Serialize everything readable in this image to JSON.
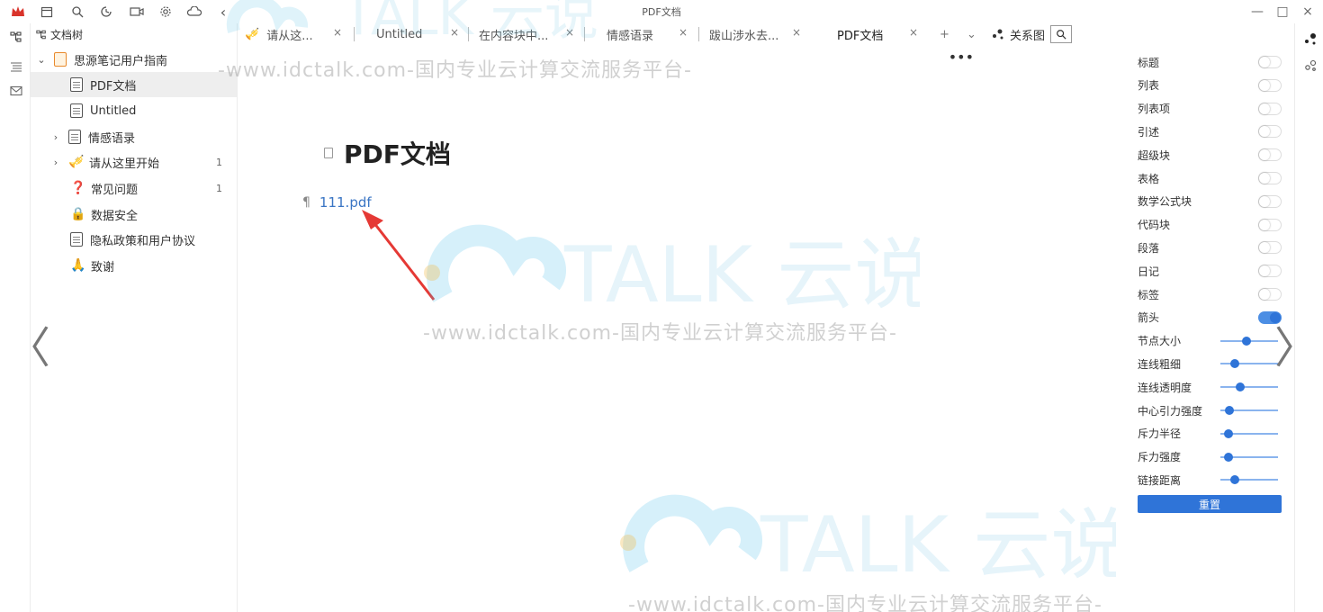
{
  "window": {
    "title": "PDF文档",
    "minimize": "—",
    "maximize": "□",
    "close": "×"
  },
  "toolbar": {
    "icons": [
      "logo-crown-icon",
      "calendar-icon",
      "search-icon",
      "history-icon",
      "record-icon",
      "settings-icon",
      "cloud-icon",
      "collapse-icon"
    ]
  },
  "filetree": {
    "header": "文档树",
    "items": [
      {
        "label": "思源笔记用户指南",
        "kind": "notebook",
        "expanded": true,
        "count": ""
      },
      {
        "label": "PDF文档",
        "kind": "doc",
        "active": true,
        "count": ""
      },
      {
        "label": "Untitled",
        "kind": "doc",
        "count": ""
      },
      {
        "label": "情感语录",
        "kind": "doc-sub",
        "count": ""
      },
      {
        "label": "请从这里开始",
        "kind": "emoji",
        "emoji": "🎺",
        "count": "1"
      },
      {
        "label": "常见问题",
        "kind": "emoji",
        "emoji": "❓",
        "count": "1"
      },
      {
        "label": "数据安全",
        "kind": "emoji",
        "emoji": "🔒",
        "count": ""
      },
      {
        "label": "隐私政策和用户协议",
        "kind": "doc",
        "count": ""
      },
      {
        "label": "致谢",
        "kind": "emoji",
        "emoji": "🙏",
        "count": ""
      }
    ]
  },
  "tabs": [
    {
      "label": "请从这...",
      "close": "×"
    },
    {
      "label": "Untitled",
      "close": "×"
    },
    {
      "label": "在内容块中...",
      "close": "×"
    },
    {
      "label": "情感语录",
      "close": "×"
    },
    {
      "label": "跋山涉水去...",
      "close": "×"
    },
    {
      "label": "PDF文档",
      "close": "×",
      "active": true
    }
  ],
  "tab_controls": {
    "add": "+",
    "more": "⌄"
  },
  "editor": {
    "more": "•••",
    "doc_title": "PDF文档",
    "pilcrow": "¶",
    "file_link": "111.pdf"
  },
  "watermark": {
    "logo_text": "TALK 云说",
    "url_text": "-www.idctalk.com-国内专业云计算交流服务平台-"
  },
  "graph": {
    "label": "关系图"
  },
  "graph_settings": {
    "toggles": [
      {
        "label": "标题",
        "on": false
      },
      {
        "label": "列表",
        "on": false
      },
      {
        "label": "列表项",
        "on": false
      },
      {
        "label": "引述",
        "on": false
      },
      {
        "label": "超级块",
        "on": false
      },
      {
        "label": "表格",
        "on": false
      },
      {
        "label": "数学公式块",
        "on": false
      },
      {
        "label": "代码块",
        "on": false
      },
      {
        "label": "段落",
        "on": false
      },
      {
        "label": "日记",
        "on": false
      },
      {
        "label": "标签",
        "on": false
      },
      {
        "label": "箭头",
        "on": true
      }
    ],
    "sliders": [
      {
        "label": "节点大小",
        "value": 0.45
      },
      {
        "label": "连线粗细",
        "value": 0.2
      },
      {
        "label": "连线透明度",
        "value": 0.32
      },
      {
        "label": "中心引力强度",
        "value": 0.1
      },
      {
        "label": "斥力半径",
        "value": 0.08
      },
      {
        "label": "斥力强度",
        "value": 0.08
      },
      {
        "label": "链接距离",
        "value": 0.2
      }
    ],
    "reset": "重置"
  },
  "nav": {
    "prev": "〈",
    "next": "〉"
  }
}
